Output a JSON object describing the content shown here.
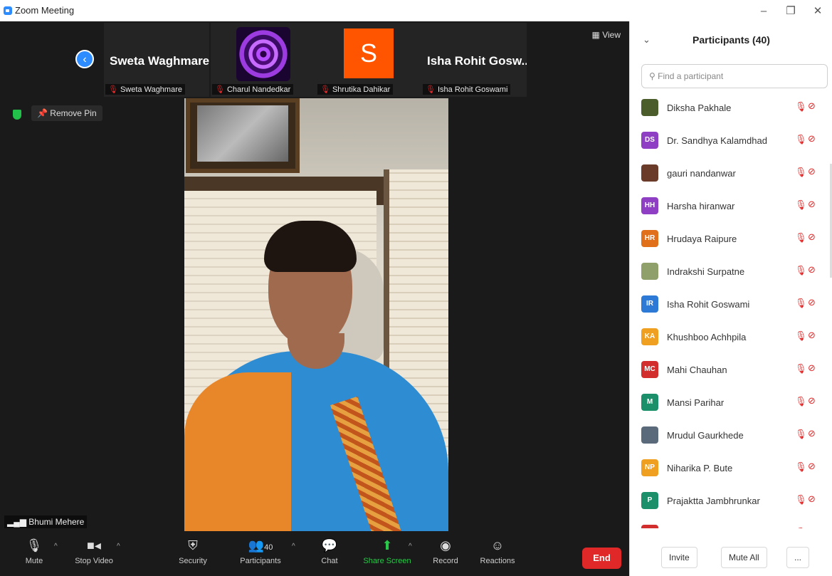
{
  "window": {
    "title": "Zoom Meeting",
    "min": "–",
    "restore": "❐",
    "close": "✕"
  },
  "strip": {
    "back_icon": "‹",
    "view_label": "View",
    "tiles": [
      {
        "display": "Sweta Waghmare",
        "label": "Sweta Waghmare"
      },
      {
        "display": "",
        "label": "Charul Nandedkar"
      },
      {
        "display": "S",
        "label": "Shrutika Dahikar"
      },
      {
        "display": "Isha Rohit Gosw...",
        "label": "Isha Rohit Goswami"
      }
    ]
  },
  "main": {
    "remove_pin": "Remove Pin",
    "speaker": "Bhumi Mehere"
  },
  "toolbar": {
    "mute": "Mute",
    "stop_video": "Stop Video",
    "security": "Security",
    "participants": "Participants",
    "participants_count": "40",
    "chat": "Chat",
    "share": "Share Screen",
    "record": "Record",
    "reactions": "Reactions",
    "end": "End"
  },
  "panel": {
    "title": "Participants (40)",
    "search_placeholder": "Find a participant",
    "participants": [
      {
        "initials": "",
        "name": "Diksha Pakhale",
        "color": "#4a5d2a"
      },
      {
        "initials": "DS",
        "name": "Dr. Sandhya Kalamdhad",
        "color": "#8e3fc4"
      },
      {
        "initials": "",
        "name": "gauri nandanwar",
        "color": "#6b3b2a"
      },
      {
        "initials": "HH",
        "name": "Harsha hiranwar",
        "color": "#8e3fc4"
      },
      {
        "initials": "HR",
        "name": "Hrudaya Raipure",
        "color": "#e0701a"
      },
      {
        "initials": "",
        "name": "Indrakshi Surpatne",
        "color": "#8fa06a"
      },
      {
        "initials": "IR",
        "name": "Isha Rohit Goswami",
        "color": "#2d7ad6"
      },
      {
        "initials": "KA",
        "name": "Khushboo Achhpila",
        "color": "#f0a020"
      },
      {
        "initials": "MC",
        "name": "Mahi Chauhan",
        "color": "#d22e2e"
      },
      {
        "initials": "M",
        "name": "Mansi Parihar",
        "color": "#1a8f6a"
      },
      {
        "initials": "",
        "name": "Mrudul Gaurkhede",
        "color": "#5a6a7a"
      },
      {
        "initials": "NP",
        "name": "Niharika P. Bute",
        "color": "#f0a020"
      },
      {
        "initials": "P",
        "name": "Prajaktta Jambhrunkar",
        "color": "#1a8f6a"
      },
      {
        "initials": "",
        "name": "",
        "color": "#d22e2e"
      }
    ],
    "invite": "Invite",
    "mute_all": "Mute All",
    "more": "..."
  }
}
